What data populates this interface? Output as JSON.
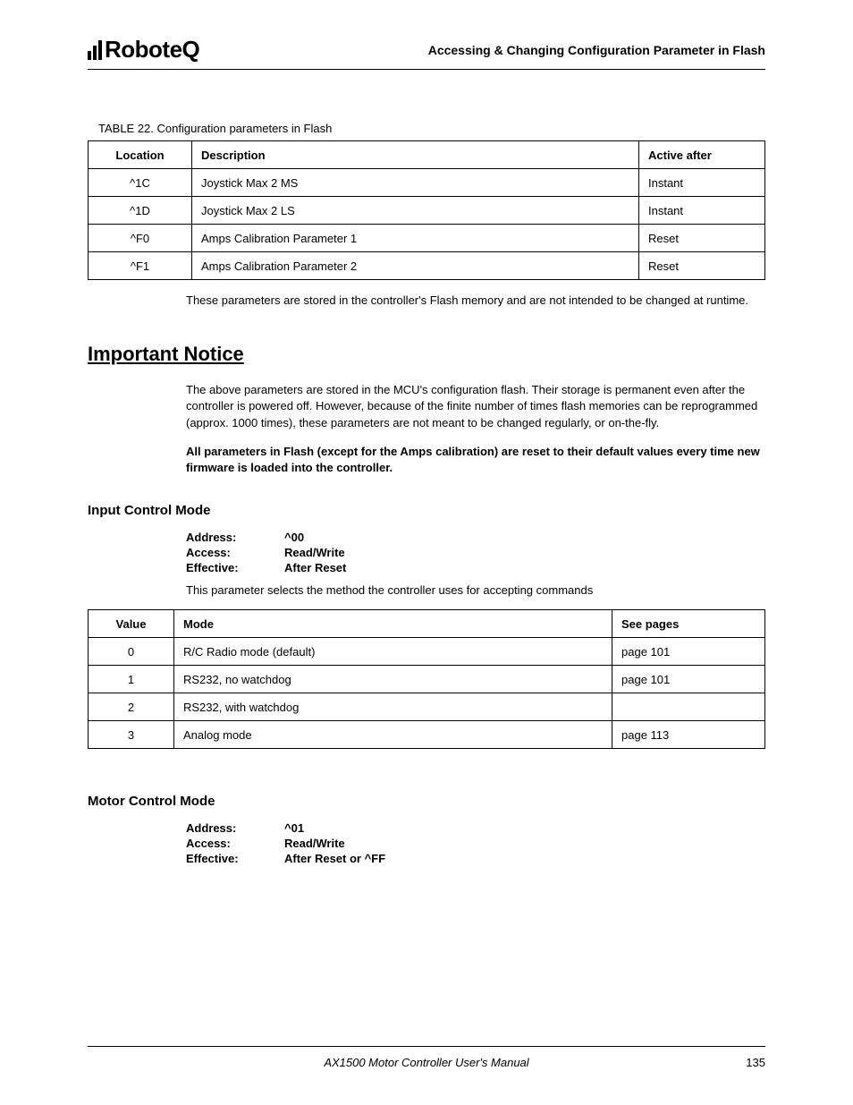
{
  "header": {
    "logo_text": "RoboteQ",
    "title": "Accessing & Changing Configuration Parameter in Flash"
  },
  "table22": {
    "caption_prefix": "TABLE 22. ",
    "caption": "Configuration parameters in Flash",
    "headers": {
      "location": "Location",
      "description": "Description",
      "active": "Active after"
    },
    "rows": [
      {
        "location": "^1C",
        "description": "Joystick Max 2 MS",
        "active": "Instant"
      },
      {
        "location": "^1D",
        "description": "Joystick Max 2 LS",
        "active": "Instant"
      },
      {
        "location": "^F0",
        "description": "Amps Calibration Parameter 1",
        "active": "Reset"
      },
      {
        "location": "^F1",
        "description": "Amps Calibration Parameter 2",
        "active": "Reset"
      }
    ]
  },
  "para1": "These parameters are stored in the controller's Flash memory and are not intended to be changed at runtime.",
  "notice": {
    "title": "Important Notice",
    "para": "The above parameters are stored in the MCU's configuration flash. Their storage is permanent even after the controller is powered off. However, because of the finite number of times flash memories can be reprogrammed (approx. 1000 times), these parameters are not meant to be changed regularly, or on-the-fly.",
    "bold": "All parameters in Flash (except for the Amps calibration) are reset to their default values every time new firmware is loaded into the controller."
  },
  "input_mode": {
    "heading": "Input Control Mode",
    "address_label": "Address:",
    "address_value": "^00",
    "access_label": "Access:",
    "access_value": "Read/Write",
    "effective_label": "Effective:",
    "effective_value": "After Reset",
    "desc": "This parameter selects the method the controller uses for accepting commands",
    "table": {
      "headers": {
        "value": "Value",
        "mode": "Mode",
        "see": "See pages"
      },
      "rows": [
        {
          "value": "0",
          "mode": "R/C Radio mode (default)",
          "see": "page 101"
        },
        {
          "value": "1",
          "mode": "RS232, no watchdog",
          "see": "page 101"
        },
        {
          "value": "2",
          "mode": "RS232, with watchdog",
          "see": ""
        },
        {
          "value": "3",
          "mode": "Analog mode",
          "see": "page 113"
        }
      ]
    }
  },
  "motor_mode": {
    "heading": "Motor Control Mode",
    "address_label": "Address:",
    "address_value": "^01",
    "access_label": "Access:",
    "access_value": "Read/Write",
    "effective_label": "Effective:",
    "effective_value": "After Reset or ^FF"
  },
  "footer": {
    "title": "AX1500 Motor Controller User's Manual",
    "page": "135"
  }
}
